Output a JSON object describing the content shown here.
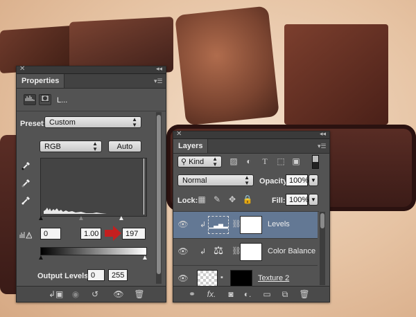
{
  "properties_panel": {
    "tab_title": "Properties",
    "adjustment_abbrev": "L...",
    "preset_label": "Preset:",
    "preset_value": "Custom",
    "channel_value": "RGB",
    "auto_label": "Auto",
    "input_black": "0",
    "input_gray": "1.00",
    "input_white": "197",
    "output_label": "Output Levels:",
    "output_black": "0",
    "output_white": "255"
  },
  "layers_panel": {
    "tab_title": "Layers",
    "filter_kind": "Kind",
    "blend_mode": "Normal",
    "opacity_label": "Opacity:",
    "opacity_value": "100%",
    "lock_label": "Lock:",
    "fill_label": "Fill:",
    "fill_value": "100%",
    "layers": [
      {
        "name": "Levels"
      },
      {
        "name": "Color Balance"
      },
      {
        "name": "Texture 2"
      }
    ]
  },
  "colors": {
    "panel_bg": "#535353",
    "selected_layer": "#637894",
    "arrow_red": "#c41f1f"
  }
}
